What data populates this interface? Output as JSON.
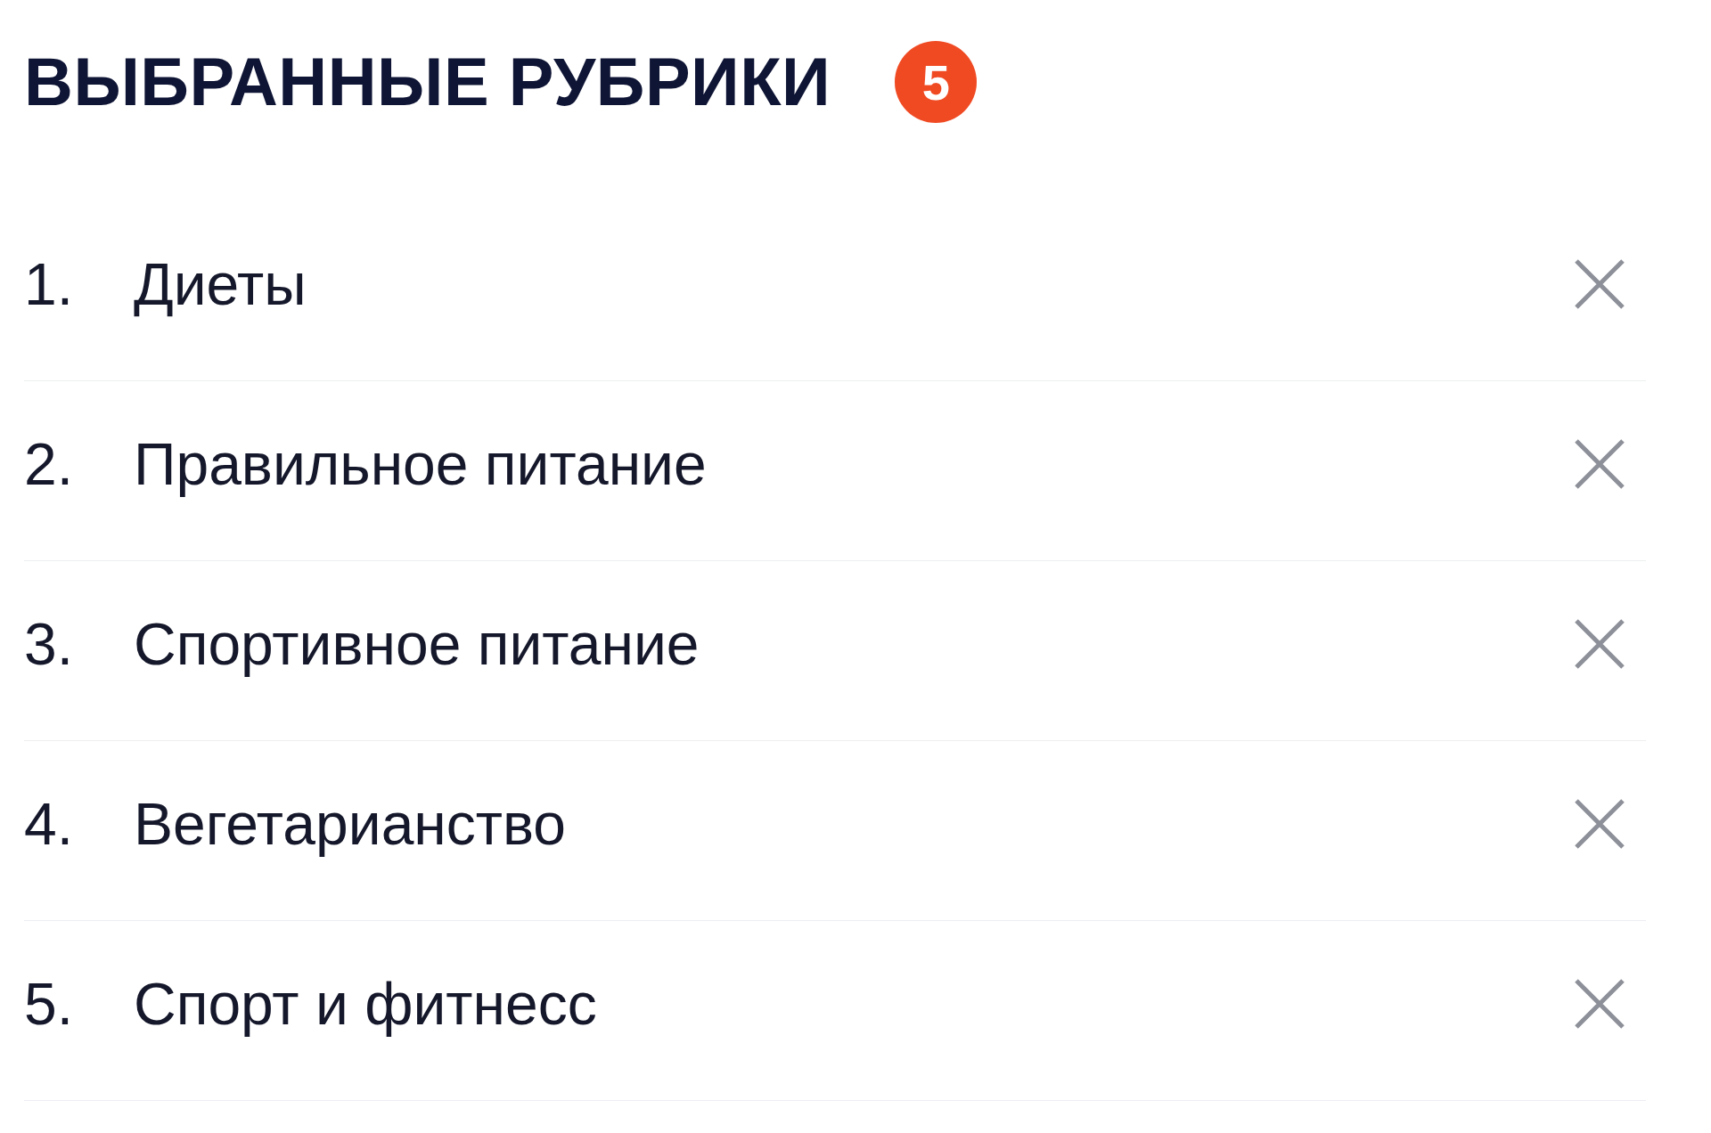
{
  "header": {
    "title": "ВЫБРАННЫЕ РУБРИКИ",
    "count": "5"
  },
  "items": [
    {
      "number": "1.",
      "label": "Диеты"
    },
    {
      "number": "2.",
      "label": "Правильное питание"
    },
    {
      "number": "3.",
      "label": "Спортивное питание"
    },
    {
      "number": "4.",
      "label": "Вегетарианство"
    },
    {
      "number": "5.",
      "label": "Спорт и фитнесс"
    }
  ]
}
